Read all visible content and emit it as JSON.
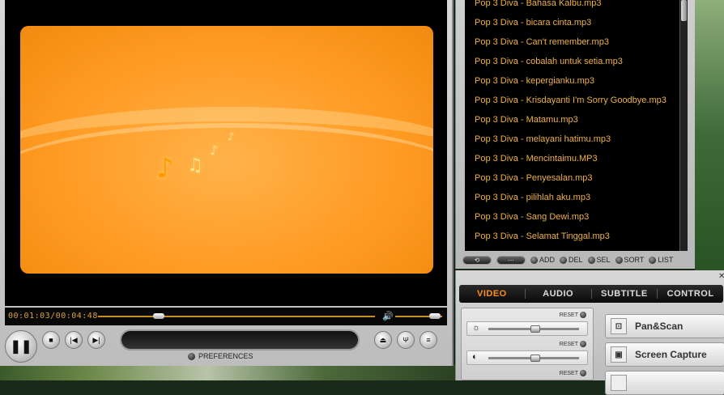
{
  "player": {
    "timecode": "00:01:03/00:04:48",
    "seek_progress": 0.22,
    "volume_level": 0.85,
    "preferences_label": "PREFERENCES"
  },
  "playlist": {
    "items": [
      "Pop 3 Diva - Bahasa Kalbu.mp3",
      "Pop 3 Diva - bicara cinta.mp3",
      "Pop 3 Diva - Can't remember.mp3",
      "Pop 3 Diva - cobalah untuk setia.mp3",
      "Pop 3 Diva - kepergianku.mp3",
      "Pop 3 Diva - Krisdayanti I'm Sorry Goodbye.mp3",
      "Pop 3 Diva - Matamu.mp3",
      "Pop 3 Diva - melayani hatimu.mp3",
      "Pop 3 Diva - Mencintaimu.MP3",
      "Pop 3 Diva - Penyesalan.mp3",
      "Pop 3 Diva - pilihlah aku.mp3",
      "Pop 3 Diva - Sang Dewi.mp3",
      "Pop 3 Diva - Selamat Tinggal.mp3"
    ],
    "buttons": {
      "add": "ADD",
      "del": "DEL",
      "sel": "SEL",
      "sort": "SORT",
      "list": "LIST"
    }
  },
  "settings": {
    "tabs": [
      "VIDEO",
      "AUDIO",
      "SUBTITLE",
      "CONTROL"
    ],
    "active_tab": "VIDEO",
    "reset_label": "RESET",
    "modes": [
      "Pan&Scan",
      "Screen Capture"
    ]
  },
  "icons": {
    "play_pause": "pause-icon",
    "stop": "stop-icon",
    "prev": "prev-icon",
    "next": "next-icon",
    "eject": "eject-icon",
    "equalizer": "equalizer-icon",
    "playlist_toggle": "playlist-icon",
    "brightness": "sun-icon",
    "contrast": "contrast-icon"
  },
  "colors": {
    "accent": "#ff8c1a",
    "playlist_text": "#f0b040",
    "video_bg": "#ff9a22"
  }
}
